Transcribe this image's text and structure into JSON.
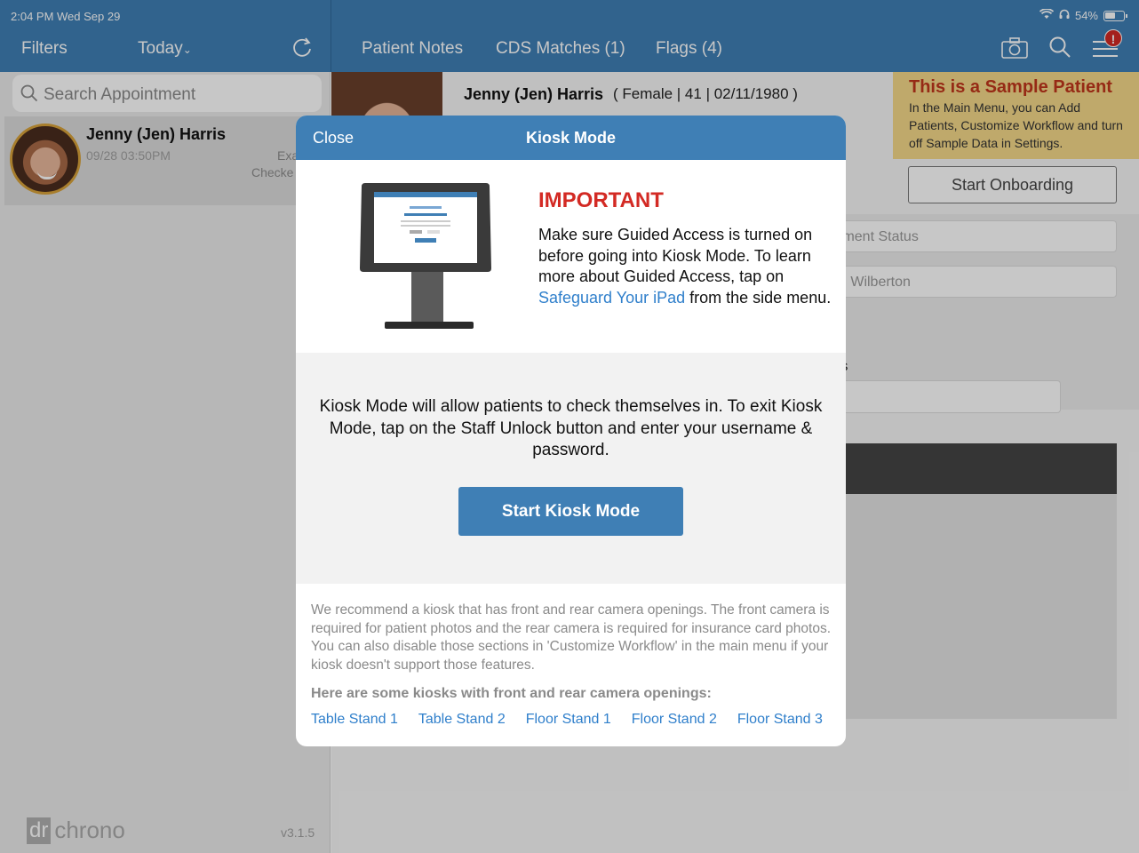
{
  "status_bar": {
    "time": "2:04 PM  Wed Sep 29",
    "battery": "54%"
  },
  "top_bar": {
    "filters": "Filters",
    "today": "Today",
    "tabs": [
      "Patient Notes",
      "CDS Matches (1)",
      "Flags (4)"
    ],
    "alert_badge": "!"
  },
  "left_pane": {
    "search_placeholder": "Search Appointment",
    "appointment": {
      "name": "Jenny (Jen) Harris",
      "time": "09/28 03:50PM",
      "status_line1": "Exa",
      "status_line2": "Checke"
    },
    "logo_dr": "dr",
    "logo_chrono": "chrono",
    "version": "v3.1.5"
  },
  "patient": {
    "name": "Jenny (Jen) Harris",
    "meta_open": "( Female | 41 | 02/11/1980 )"
  },
  "sample_banner": {
    "title": "This is a Sample Patient",
    "text": "In the Main Menu, you can Add Patients, Customize Workflow and turn off Sample Data in Settings."
  },
  "start_onboarding": "Start Onboarding",
  "background_fields": {
    "field1": "tment Status",
    "field2": "n Wilberton",
    "status_label": "tus"
  },
  "modal": {
    "close": "Close",
    "title": "Kiosk Mode",
    "important_heading": "IMPORTANT",
    "important_pre": "Make sure Guided Access is turned on before going into Kiosk Mode. To learn more about Guided Access, tap on ",
    "important_link": "Safeguard Your iPad",
    "important_post": " from the side menu.",
    "main_text": "Kiosk Mode will allow patients to check themselves in. To exit Kiosk Mode, tap on the Staff Unlock button and enter your username & password.",
    "start_button": "Start Kiosk Mode",
    "recommend_text": "We recommend a kiosk that has front and rear camera openings. The front camera is required for patient photos and the rear camera is required for insurance card photos. You can also disable those sections in 'Customize Workflow' in the main menu if your kiosk doesn't support those features.",
    "kiosk_heading": "Here are some kiosks with front and rear camera openings:",
    "stands": [
      "Table Stand 1",
      "Table Stand 2",
      "Floor Stand 1",
      "Floor Stand 2",
      "Floor Stand 3"
    ]
  }
}
